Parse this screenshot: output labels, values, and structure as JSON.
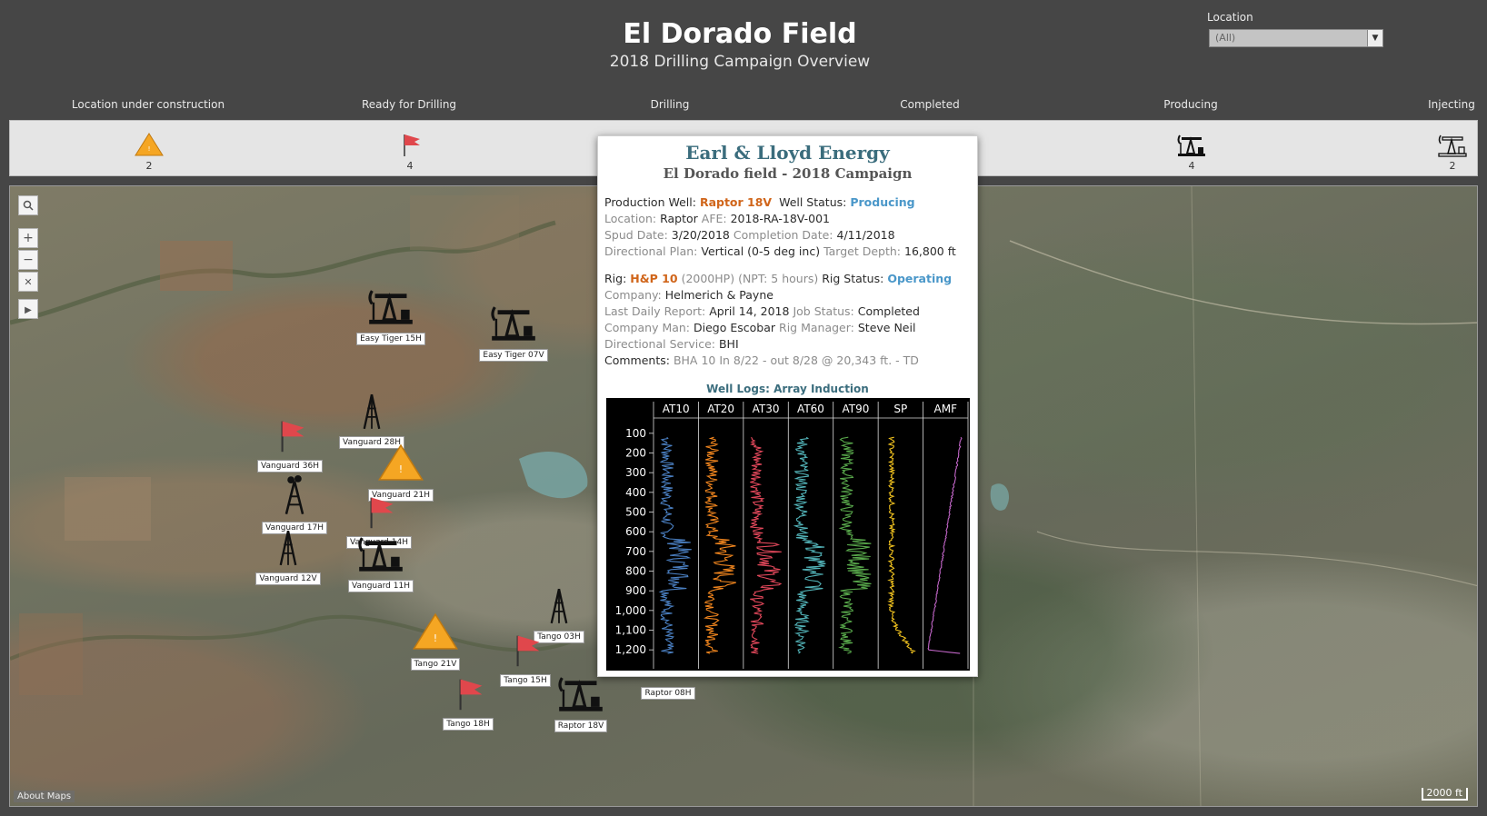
{
  "header": {
    "title": "El Dorado Field",
    "subtitle": "2018 Drilling Campaign Overview"
  },
  "filter": {
    "label": "Location",
    "value": "(All)"
  },
  "statuses": [
    {
      "label": "Location under construction",
      "count": "2",
      "icon": "under-construction-sign-icon"
    },
    {
      "label": "Ready for Drilling",
      "count": "4",
      "icon": "red-flag-icon"
    },
    {
      "label": "Drilling",
      "count": "",
      "icon": "drilling-rig-icon"
    },
    {
      "label": "Completed",
      "count": "",
      "icon": "completed-well-icon"
    },
    {
      "label": "Producing",
      "count": "4",
      "icon": "pumpjack-icon"
    },
    {
      "label": "Injecting",
      "count": "2",
      "icon": "injection-pump-icon"
    }
  ],
  "map": {
    "about": "About Maps",
    "scale": "2000 ft",
    "tools": [
      "search-icon",
      "zoom-in-icon",
      "zoom-out-icon",
      "selection-clear-icon",
      "expand-toolbar-icon"
    ],
    "wells": [
      {
        "name": "Easy Tiger 15H",
        "type": "pumpjack"
      },
      {
        "name": "Easy Tiger 07V",
        "type": "pumpjack"
      },
      {
        "name": "Vanguard 36H",
        "type": "flag"
      },
      {
        "name": "Vanguard 28H",
        "type": "rig"
      },
      {
        "name": "Vanguard 21H",
        "type": "construction"
      },
      {
        "name": "Vanguard 17H",
        "type": "completed"
      },
      {
        "name": "Vanguard 14H",
        "type": "flag"
      },
      {
        "name": "Vanguard 12V",
        "type": "rig"
      },
      {
        "name": "Vanguard 11H",
        "type": "pumpjack"
      },
      {
        "name": "Tango 03H",
        "type": "rig"
      },
      {
        "name": "Tango 21V",
        "type": "construction"
      },
      {
        "name": "Tango 15H",
        "type": "flag"
      },
      {
        "name": "Tango 18H",
        "type": "flag"
      },
      {
        "name": "Raptor 18V",
        "type": "pumpjack"
      },
      {
        "name": "Raptor 08H",
        "type": "pumpjack"
      }
    ]
  },
  "tooltip": {
    "company": "Earl & Lloyd Energy",
    "campaign": "El Dorado field - 2018 Campaign",
    "well_label": "Production Well:",
    "well": "Raptor 18V",
    "well_status_label": "Well Status:",
    "well_status": "Producing",
    "location_label": "Location:",
    "location": "Raptor",
    "afe_label": "AFE:",
    "afe": "2018-RA-18V-001",
    "spud_label": "Spud Date:",
    "spud": "3/20/2018",
    "completion_label": "Completion Date:",
    "completion": "4/11/2018",
    "dir_plan_label": "Directional Plan:",
    "dir_plan": "Vertical (0-5 deg inc)",
    "target_label": "Target Depth:",
    "target": "16,800 ft",
    "rig_label": "Rig:",
    "rig": "H&P 10",
    "rig_hp": "(2000HP)",
    "npt": "(NPT: 5 hours)",
    "rig_status_label": "Rig Status:",
    "rig_status": "Operating",
    "company_label": "Company:",
    "company_name": "Helmerich & Payne",
    "report_label": "Last Daily Report:",
    "report": "April 14, 2018",
    "job_label": "Job Status:",
    "job": "Completed",
    "man_label": "Company Man:",
    "man": "Diego Escobar",
    "manager_label": "Rig Manager:",
    "manager": "Steve Neil",
    "dirsvc_label": "Directional Service:",
    "dirsvc": "BHI",
    "comments_label": "Comments:",
    "comments": "BHA 10 In 8/22 - out 8/28 @ 20,343 ft. - TD"
  },
  "chart_data": {
    "type": "line",
    "title": "Well Logs: Array Induction",
    "tracks": [
      "AT10",
      "AT20",
      "AT30",
      "AT60",
      "AT90",
      "SP",
      "AMF"
    ],
    "colors": [
      "#4a7fc1",
      "#f0851e",
      "#e0475a",
      "#52b3b8",
      "#58a84b",
      "#f2c31f",
      "#c065c6"
    ],
    "depth_ticks": [
      "100",
      "200",
      "300",
      "400",
      "500",
      "600",
      "700",
      "800",
      "900",
      "1,000",
      "1,100",
      "1,200"
    ],
    "depth_range": [
      50,
      1250
    ],
    "background": "#000000"
  }
}
